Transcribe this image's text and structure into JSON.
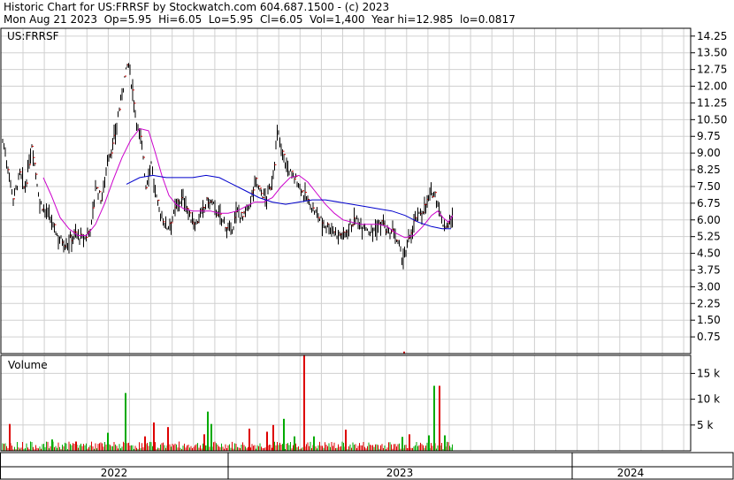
{
  "header": {
    "line1": "Historic Chart for US:FRRSF by Stockwatch.com 604.687.1500 - (c) 2023",
    "line2": "Mon Aug 21 2023  Op=5.95  Hi=6.05  Lo=5.95  Cl=6.05  Vol=1,400  Year hi=12.985  lo=0.0817"
  },
  "chart_data": [
    {
      "type": "line",
      "title": "US:FRRSF",
      "subtype": "hlc-price-bars-with-moving-averages",
      "ylim": [
        0,
        14.6
      ],
      "y_ticks": [
        "14.25",
        "13.50",
        "12.75",
        "12.00",
        "11.25",
        "10.50",
        "9.75",
        "9.00",
        "8.25",
        "7.50",
        "6.75",
        "6.00",
        "5.25",
        "4.50",
        "3.75",
        "3.00",
        "2.25",
        "1.50",
        "0.75"
      ],
      "x_labels": [
        "2022",
        "2023",
        "2024"
      ],
      "grid": true,
      "series": [
        {
          "name": "",
          "kind": "price-close",
          "color": "#000000",
          "anchors": [
            [
              0,
              9.6
            ],
            [
              5,
              8.6
            ],
            [
              12,
              7.0
            ],
            [
              20,
              8.1
            ],
            [
              25,
              7.3
            ],
            [
              33,
              9.4
            ],
            [
              42,
              6.8
            ],
            [
              52,
              6.2
            ],
            [
              62,
              5.3
            ],
            [
              72,
              4.9
            ],
            [
              82,
              5.4
            ],
            [
              92,
              5.1
            ],
            [
              100,
              5.7
            ],
            [
              105,
              7.5
            ],
            [
              112,
              6.9
            ],
            [
              118,
              8.6
            ],
            [
              125,
              9.4
            ],
            [
              132,
              11.0
            ],
            [
              138,
              12.4
            ],
            [
              142,
              13.1
            ],
            [
              147,
              11.8
            ],
            [
              152,
              10.3
            ],
            [
              158,
              9.3
            ],
            [
              162,
              7.5
            ],
            [
              168,
              8.7
            ],
            [
              172,
              7.3
            ],
            [
              178,
              6.3
            ],
            [
              186,
              5.7
            ],
            [
              192,
              6.1
            ],
            [
              198,
              6.8
            ],
            [
              205,
              7.0
            ],
            [
              212,
              6.1
            ],
            [
              218,
              5.8
            ],
            [
              225,
              6.3
            ],
            [
              232,
              6.9
            ],
            [
              238,
              6.7
            ],
            [
              245,
              6.2
            ],
            [
              252,
              5.8
            ],
            [
              258,
              5.4
            ],
            [
              265,
              6.4
            ],
            [
              272,
              6.1
            ],
            [
              280,
              6.8
            ],
            [
              286,
              7.8
            ],
            [
              292,
              7.2
            ],
            [
              298,
              7.0
            ],
            [
              304,
              7.6
            ],
            [
              308,
              8.8
            ],
            [
              311,
              10.0
            ],
            [
              316,
              9.1
            ],
            [
              322,
              8.3
            ],
            [
              328,
              8.0
            ],
            [
              334,
              7.7
            ],
            [
              340,
              7.2
            ],
            [
              346,
              6.8
            ],
            [
              352,
              6.4
            ],
            [
              358,
              6.1
            ],
            [
              364,
              5.8
            ],
            [
              370,
              5.7
            ],
            [
              378,
              5.4
            ],
            [
              386,
              5.3
            ],
            [
              392,
              5.8
            ],
            [
              400,
              6.0
            ],
            [
              408,
              5.8
            ],
            [
              416,
              5.5
            ],
            [
              424,
              5.7
            ],
            [
              430,
              5.9
            ],
            [
              436,
              5.3
            ],
            [
              442,
              5.5
            ],
            [
              448,
              4.8
            ],
            [
              452,
              4.3
            ],
            [
              456,
              4.5
            ],
            [
              460,
              5.2
            ],
            [
              464,
              5.8
            ],
            [
              470,
              6.2
            ],
            [
              476,
              6.5
            ],
            [
              482,
              7.0
            ],
            [
              488,
              7.3
            ],
            [
              492,
              6.8
            ],
            [
              496,
              6.0
            ],
            [
              500,
              5.7
            ],
            [
              505,
              5.9
            ],
            [
              509,
              6.05
            ]
          ]
        },
        {
          "name": "",
          "kind": "moving-average",
          "color": "#cc00cc",
          "points": [
            [
              46,
              7.9
            ],
            [
              55,
              7.1
            ],
            [
              65,
              6.1
            ],
            [
              75,
              5.6
            ],
            [
              85,
              5.3
            ],
            [
              95,
              5.3
            ],
            [
              105,
              5.8
            ],
            [
              115,
              6.7
            ],
            [
              125,
              7.8
            ],
            [
              135,
              8.8
            ],
            [
              145,
              9.6
            ],
            [
              155,
              10.1
            ],
            [
              165,
              10.0
            ],
            [
              172,
              9.1
            ],
            [
              180,
              8.0
            ],
            [
              188,
              7.1
            ],
            [
              196,
              6.7
            ],
            [
              205,
              6.5
            ],
            [
              215,
              6.4
            ],
            [
              225,
              6.4
            ],
            [
              235,
              6.4
            ],
            [
              245,
              6.3
            ],
            [
              255,
              6.3
            ],
            [
              265,
              6.4
            ],
            [
              275,
              6.6
            ],
            [
              285,
              6.8
            ],
            [
              295,
              6.8
            ],
            [
              305,
              7.0
            ],
            [
              315,
              7.5
            ],
            [
              325,
              7.9
            ],
            [
              335,
              8.0
            ],
            [
              345,
              7.7
            ],
            [
              355,
              7.2
            ],
            [
              365,
              6.7
            ],
            [
              375,
              6.3
            ],
            [
              385,
              6.0
            ],
            [
              395,
              5.9
            ],
            [
              405,
              5.8
            ],
            [
              415,
              5.8
            ],
            [
              425,
              5.8
            ],
            [
              435,
              5.7
            ],
            [
              445,
              5.4
            ],
            [
              455,
              5.2
            ],
            [
              465,
              5.3
            ],
            [
              475,
              5.7
            ],
            [
              485,
              6.2
            ],
            [
              492,
              6.4
            ],
            [
              498,
              6.1
            ],
            [
              504,
              5.9
            ],
            [
              509,
              6.2
            ]
          ]
        },
        {
          "name": "",
          "kind": "moving-average",
          "color": "#0000cc",
          "points": [
            [
              140,
              7.6
            ],
            [
              155,
              7.9
            ],
            [
              170,
              8.0
            ],
            [
              185,
              7.9
            ],
            [
              200,
              7.9
            ],
            [
              215,
              7.9
            ],
            [
              230,
              8.0
            ],
            [
              245,
              7.9
            ],
            [
              260,
              7.6
            ],
            [
              275,
              7.3
            ],
            [
              290,
              7.0
            ],
            [
              305,
              6.8
            ],
            [
              320,
              6.7
            ],
            [
              335,
              6.8
            ],
            [
              350,
              6.9
            ],
            [
              365,
              6.9
            ],
            [
              380,
              6.8
            ],
            [
              395,
              6.7
            ],
            [
              410,
              6.6
            ],
            [
              425,
              6.5
            ],
            [
              440,
              6.4
            ],
            [
              455,
              6.2
            ],
            [
              470,
              5.9
            ],
            [
              485,
              5.7
            ],
            [
              497,
              5.6
            ],
            [
              507,
              5.6
            ]
          ]
        }
      ]
    },
    {
      "type": "bar",
      "title": "Volume",
      "y_ticks": [
        "15 k",
        "10 k",
        "5 k"
      ],
      "ylim": [
        0,
        18500
      ],
      "grid": true,
      "series": [
        {
          "name": "",
          "colors": {
            "up": "#00aa00",
            "down": "#dd0000"
          }
        }
      ],
      "spikes": [
        {
          "t": 8,
          "v": 5200,
          "up": false
        },
        {
          "t": 56,
          "v": 2200,
          "up": true
        },
        {
          "t": 83,
          "v": 1800,
          "up": false
        },
        {
          "t": 119,
          "v": 3500,
          "up": true
        },
        {
          "t": 139,
          "v": 11200,
          "up": true
        },
        {
          "t": 161,
          "v": 2800,
          "up": false
        },
        {
          "t": 171,
          "v": 5500,
          "up": false
        },
        {
          "t": 187,
          "v": 4600,
          "up": false
        },
        {
          "t": 228,
          "v": 3200,
          "up": false
        },
        {
          "t": 232,
          "v": 7600,
          "up": true
        },
        {
          "t": 236,
          "v": 5200,
          "up": true
        },
        {
          "t": 279,
          "v": 4300,
          "up": false
        },
        {
          "t": 299,
          "v": 3700,
          "up": false
        },
        {
          "t": 306,
          "v": 5000,
          "up": false
        },
        {
          "t": 318,
          "v": 6200,
          "up": true
        },
        {
          "t": 330,
          "v": 2800,
          "up": true
        },
        {
          "t": 341,
          "v": 18600,
          "up": false
        },
        {
          "t": 352,
          "v": 2800,
          "up": true
        },
        {
          "t": 388,
          "v": 4100,
          "up": false
        },
        {
          "t": 452,
          "v": 2700,
          "up": true
        },
        {
          "t": 460,
          "v": 3200,
          "up": false
        },
        {
          "t": 482,
          "v": 3000,
          "up": true
        },
        {
          "t": 488,
          "v": 12600,
          "up": true
        },
        {
          "t": 494,
          "v": 12600,
          "up": false
        },
        {
          "t": 500,
          "v": 3000,
          "up": true
        }
      ]
    }
  ]
}
